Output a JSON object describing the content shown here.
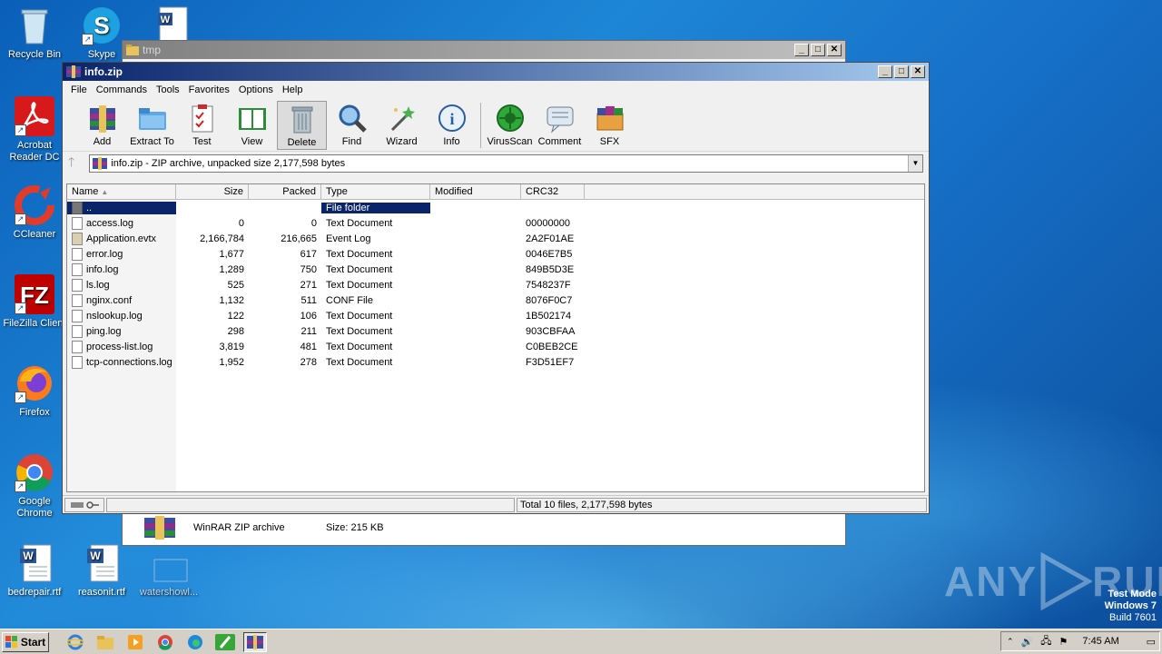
{
  "desktop": {
    "icons": [
      {
        "label": "Recycle Bin"
      },
      {
        "label": "Skype"
      },
      {
        "label": "Acrobat Reader DC"
      },
      {
        "label": "CCleaner"
      },
      {
        "label": "FileZilla Client"
      },
      {
        "label": "Firefox"
      },
      {
        "label": "Google Chrome"
      },
      {
        "label": "bedrepair.rtf"
      },
      {
        "label": "reasonit.rtf"
      },
      {
        "label": "watershowl..."
      }
    ],
    "watermark": {
      "brand": "ANY",
      "brand2": "RUN"
    },
    "os_info": {
      "line1": "Test Mode",
      "line2": "Windows 7",
      "line3": "Build 7601"
    }
  },
  "bg_window": {
    "title": "tmp",
    "file_type": "WinRAR ZIP archive",
    "file_size": "Size: 215 KB"
  },
  "winrar": {
    "title": "info.zip",
    "menu": [
      "File",
      "Commands",
      "Tools",
      "Favorites",
      "Options",
      "Help"
    ],
    "toolbar": [
      {
        "label": "Add",
        "icon": "add-archive-icon"
      },
      {
        "label": "Extract To",
        "icon": "extract-folder-icon"
      },
      {
        "label": "Test",
        "icon": "test-clipboard-icon"
      },
      {
        "label": "View",
        "icon": "view-book-icon"
      },
      {
        "label": "Delete",
        "icon": "trash-icon"
      },
      {
        "label": "Find",
        "icon": "magnifier-icon"
      },
      {
        "label": "Wizard",
        "icon": "wand-icon"
      },
      {
        "label": "Info",
        "icon": "info-icon"
      },
      {
        "label": "VirusScan",
        "icon": "virus-icon"
      },
      {
        "label": "Comment",
        "icon": "comment-icon"
      },
      {
        "label": "SFX",
        "icon": "sfx-box-icon"
      }
    ],
    "address": "info.zip - ZIP archive, unpacked size 2,177,598 bytes",
    "columns": [
      "Name",
      "Size",
      "Packed",
      "Type",
      "Modified",
      "CRC32"
    ],
    "files": [
      {
        "name": "..",
        "size": "",
        "packed": "",
        "type": "File folder",
        "modified": "",
        "crc": ""
      },
      {
        "name": "access.log",
        "size": "0",
        "packed": "0",
        "type": "Text Document",
        "modified": "",
        "crc": "00000000"
      },
      {
        "name": "Application.evtx",
        "size": "2,166,784",
        "packed": "216,665",
        "type": "Event Log",
        "modified": "",
        "crc": "2A2F01AE"
      },
      {
        "name": "error.log",
        "size": "1,677",
        "packed": "617",
        "type": "Text Document",
        "modified": "",
        "crc": "0046E7B5"
      },
      {
        "name": "info.log",
        "size": "1,289",
        "packed": "750",
        "type": "Text Document",
        "modified": "",
        "crc": "849B5D3E"
      },
      {
        "name": "ls.log",
        "size": "525",
        "packed": "271",
        "type": "Text Document",
        "modified": "",
        "crc": "7548237F"
      },
      {
        "name": "nginx.conf",
        "size": "1,132",
        "packed": "511",
        "type": "CONF File",
        "modified": "",
        "crc": "8076F0C7"
      },
      {
        "name": "nslookup.log",
        "size": "122",
        "packed": "106",
        "type": "Text Document",
        "modified": "",
        "crc": "1B502174"
      },
      {
        "name": "ping.log",
        "size": "298",
        "packed": "211",
        "type": "Text Document",
        "modified": "",
        "crc": "903CBFAA"
      },
      {
        "name": "process-list.log",
        "size": "3,819",
        "packed": "481",
        "type": "Text Document",
        "modified": "",
        "crc": "C0BEB2CE"
      },
      {
        "name": "tcp-connections.log",
        "size": "1,952",
        "packed": "278",
        "type": "Text Document",
        "modified": "",
        "crc": "F3D51EF7"
      }
    ],
    "status": "Total 10 files, 2,177,598 bytes"
  },
  "taskbar": {
    "start_label": "Start",
    "clock": "7:45 AM"
  }
}
